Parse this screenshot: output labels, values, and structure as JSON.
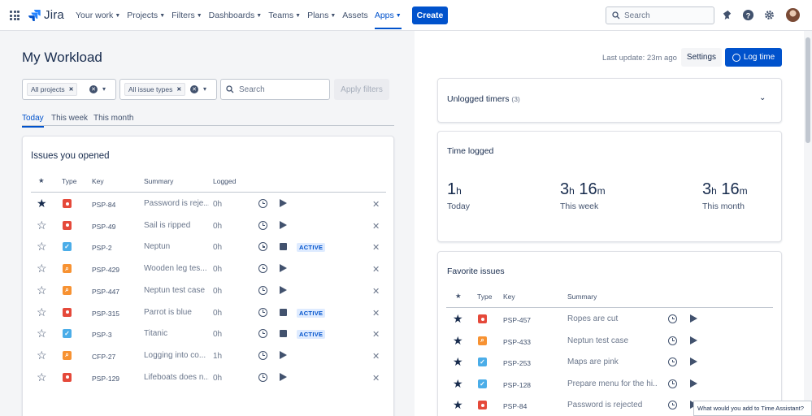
{
  "nav": {
    "logo": "Jira",
    "items": [
      {
        "label": "Your work",
        "chevron": true
      },
      {
        "label": "Projects",
        "chevron": true
      },
      {
        "label": "Filters",
        "chevron": true
      },
      {
        "label": "Dashboards",
        "chevron": true
      },
      {
        "label": "Teams",
        "chevron": true
      },
      {
        "label": "Plans",
        "chevron": true
      },
      {
        "label": "Assets",
        "chevron": false
      },
      {
        "label": "Apps",
        "chevron": true,
        "active": true
      }
    ],
    "create_label": "Create",
    "search_placeholder": "Search"
  },
  "page": {
    "title": "My Workload",
    "filters": {
      "projects_tag": "All projects",
      "issue_types_tag": "All issue types",
      "search_placeholder": "Search",
      "apply_label": "Apply filters"
    },
    "tabs": [
      {
        "label": "Today",
        "active": true
      },
      {
        "label": "This week",
        "active": false
      },
      {
        "label": "This month",
        "active": false
      }
    ]
  },
  "opened": {
    "title": "Issues you opened",
    "headers": {
      "star": "★",
      "type": "Type",
      "key": "Key",
      "summary": "Summary",
      "logged": "Logged"
    },
    "rows": [
      {
        "starred": true,
        "type": "bug",
        "key": "PSP-84",
        "summary": "Password is reje...",
        "logged": "0h",
        "timer": "play",
        "badge": ""
      },
      {
        "starred": false,
        "type": "bug",
        "key": "PSP-49",
        "summary": "Sail is ripped",
        "logged": "0h",
        "timer": "play",
        "badge": ""
      },
      {
        "starred": false,
        "type": "task",
        "key": "PSP-2",
        "summary": "Neptun",
        "logged": "0h",
        "timer": "stop",
        "badge": "ACTIVE"
      },
      {
        "starred": false,
        "type": "test",
        "key": "PSP-429",
        "summary": "Wooden leg tes...",
        "logged": "0h",
        "timer": "play",
        "badge": ""
      },
      {
        "starred": false,
        "type": "test",
        "key": "PSP-447",
        "summary": "Neptun test case",
        "logged": "0h",
        "timer": "play",
        "badge": ""
      },
      {
        "starred": false,
        "type": "bug",
        "key": "PSP-315",
        "summary": "Parrot is blue",
        "logged": "0h",
        "timer": "stop",
        "badge": "ACTIVE"
      },
      {
        "starred": false,
        "type": "task",
        "key": "PSP-3",
        "summary": "Titanic",
        "logged": "0h",
        "timer": "stop",
        "badge": "ACTIVE"
      },
      {
        "starred": false,
        "type": "test",
        "key": "CFP-27",
        "summary": "Logging into co...",
        "logged": "1h",
        "timer": "play",
        "badge": ""
      },
      {
        "starred": false,
        "type": "bug",
        "key": "PSP-129",
        "summary": "Lifeboats does n...",
        "logged": "0h",
        "timer": "play",
        "badge": ""
      }
    ]
  },
  "right": {
    "last_update": "Last update: 23m ago",
    "settings_label": "Settings",
    "logtime_label": "Log time",
    "unlogged": {
      "title": "Unlogged timers",
      "count": "(3)"
    },
    "time_logged": {
      "title": "Time logged",
      "stats": [
        {
          "value": "1",
          "unit": "h",
          "label": "Today"
        },
        {
          "value": "3",
          "unit": "h",
          "value2": "16",
          "unit2": "m",
          "label": "This week"
        },
        {
          "value": "3",
          "unit": "h",
          "value2": "16",
          "unit2": "m",
          "label": "This month"
        }
      ]
    },
    "favorites": {
      "title": "Favorite issues",
      "headers": {
        "star": "★",
        "type": "Type",
        "key": "Key",
        "summary": "Summary"
      },
      "rows": [
        {
          "type": "bug",
          "key": "PSP-457",
          "summary": "Ropes are cut"
        },
        {
          "type": "test",
          "key": "PSP-433",
          "summary": "Neptun test case"
        },
        {
          "type": "task",
          "key": "PSP-253",
          "summary": "Maps are pink"
        },
        {
          "type": "task",
          "key": "PSP-128",
          "summary": "Prepare menu for the hi..."
        },
        {
          "type": "bug",
          "key": "PSP-84",
          "summary": "Password is rejected"
        }
      ]
    }
  },
  "feedback": "What would you add to Time Assistant?"
}
